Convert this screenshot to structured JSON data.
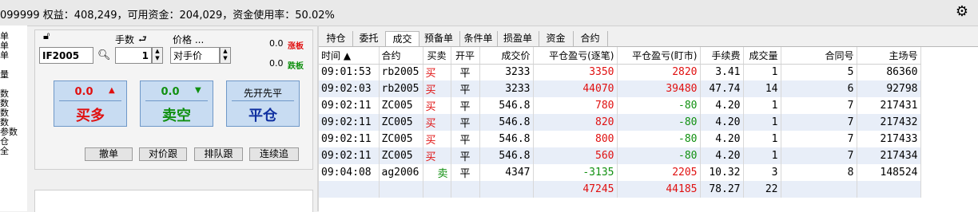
{
  "status_bar": {
    "text": "099999  权益：408,249，可用资金：204,029，资金使用率：50.02%"
  },
  "left_strip": {
    "items": [
      "单",
      "单",
      "单",
      "",
      "量",
      "",
      "数",
      "数",
      "数",
      "数",
      "参数",
      "仓",
      "全"
    ]
  },
  "order_panel": {
    "qty_label": "手数",
    "price_label": "价格 ...",
    "contract_value": "IF2005",
    "qty_value": "1",
    "price_value": "对手价",
    "limit_up": {
      "value": "0.0",
      "label": "涨板"
    },
    "limit_down": {
      "value": "0.0",
      "label": "跌板"
    },
    "buy": {
      "value": "0.0",
      "arrow": "▲",
      "label": "买多"
    },
    "sell": {
      "value": "0.0",
      "arrow": "▼",
      "label": "卖空"
    },
    "close": {
      "sub": "先开先平",
      "label": "平仓"
    },
    "buttons": [
      "撤单",
      "对价跟",
      "排队跟",
      "连续追"
    ]
  },
  "tabs": [
    "持仓",
    "委托",
    "成交",
    "预备单",
    "条件单",
    "损盈单",
    "资金",
    "合约"
  ],
  "active_tab": 2,
  "columns": [
    "时间 ▲",
    "合约",
    "买卖",
    "开平",
    "成交价",
    "平仓盈亏(逐笔)",
    "平仓盈亏(盯市)",
    "手续费",
    "成交量",
    "合同号",
    "主场号"
  ],
  "rows": [
    {
      "time": "09:01:53",
      "contract": "rb2005",
      "side": "买",
      "oc": "平",
      "price": "3233",
      "pnl_trade": "3350",
      "pnl_mtm": "2820",
      "fee": "3.41",
      "vol": "1",
      "order_no": "5",
      "exch_no": "86360"
    },
    {
      "time": "09:02:03",
      "contract": "rb2005",
      "side": "买",
      "oc": "平",
      "price": "3233",
      "pnl_trade": "44070",
      "pnl_mtm": "39480",
      "fee": "47.74",
      "vol": "14",
      "order_no": "6",
      "exch_no": "92798"
    },
    {
      "time": "09:02:11",
      "contract": "ZC005",
      "side": "买",
      "oc": "平",
      "price": "546.8",
      "pnl_trade": "780",
      "pnl_mtm": "-80",
      "fee": "4.20",
      "vol": "1",
      "order_no": "7",
      "exch_no": "217431"
    },
    {
      "time": "09:02:11",
      "contract": "ZC005",
      "side": "买",
      "oc": "平",
      "price": "546.8",
      "pnl_trade": "820",
      "pnl_mtm": "-80",
      "fee": "4.20",
      "vol": "1",
      "order_no": "7",
      "exch_no": "217432"
    },
    {
      "time": "09:02:11",
      "contract": "ZC005",
      "side": "买",
      "oc": "平",
      "price": "546.8",
      "pnl_trade": "800",
      "pnl_mtm": "-80",
      "fee": "4.20",
      "vol": "1",
      "order_no": "7",
      "exch_no": "217433"
    },
    {
      "time": "09:02:11",
      "contract": "ZC005",
      "side": "买",
      "oc": "平",
      "price": "546.8",
      "pnl_trade": "560",
      "pnl_mtm": "-80",
      "fee": "4.20",
      "vol": "1",
      "order_no": "7",
      "exch_no": "217434"
    },
    {
      "time": "09:04:08",
      "contract": "ag2006",
      "side": "卖",
      "oc": "平",
      "price": "4347",
      "pnl_trade": "-3135",
      "pnl_mtm": "2205",
      "fee": "10.32",
      "vol": "3",
      "order_no": "8",
      "exch_no": "148524"
    }
  ],
  "totals": {
    "pnl_trade": "47245",
    "pnl_mtm": "44185",
    "fee": "78.27",
    "vol": "22"
  },
  "colors": {
    "profit": "#e01010",
    "loss": "#109010"
  }
}
